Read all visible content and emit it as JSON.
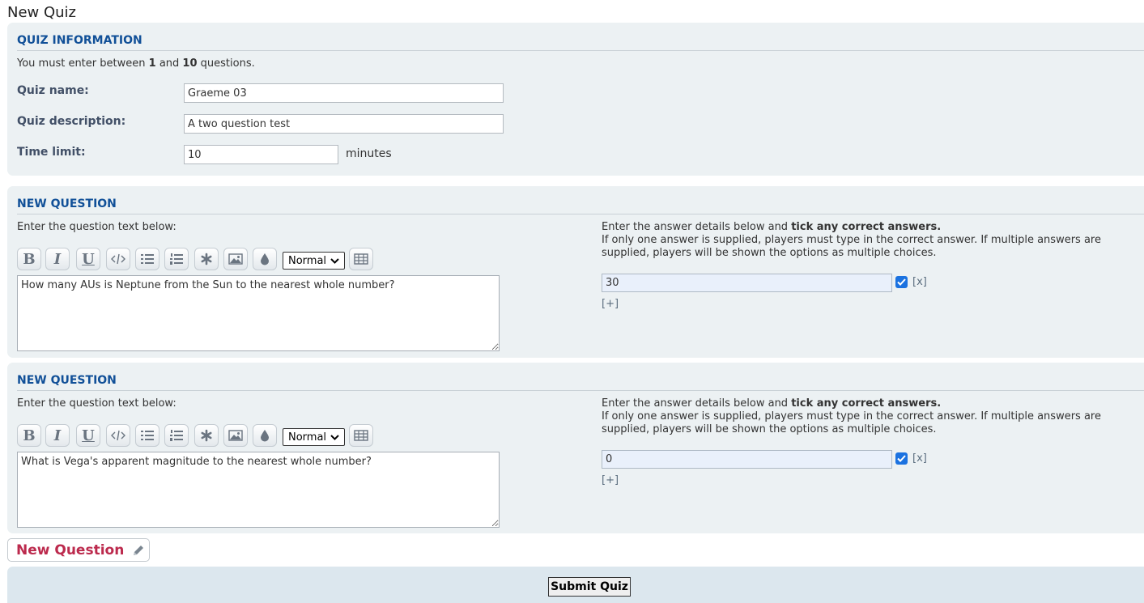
{
  "page": {
    "title": "New Quiz"
  },
  "info": {
    "heading": "QUIZ INFORMATION",
    "note_prefix": "You must enter between",
    "min_questions": "1",
    "note_and": "and",
    "max_questions": "10",
    "note_suffix": "questions.",
    "name_label": "Quiz name:",
    "name_value": "Graeme 03",
    "desc_label": "Quiz description:",
    "desc_value": "A two question test",
    "time_label": "Time limit:",
    "time_value": "10",
    "time_unit": "minutes"
  },
  "questions": [
    {
      "heading": "NEW QUESTION",
      "prompt": "Enter the question text below:",
      "size_option": "Normal",
      "text": "How many AUs is Neptune from the Sun to the nearest whole number?",
      "answer_intro": "Enter the answer details below and",
      "answer_intro_bold": "tick any correct answers.",
      "answer_help": "If only one answer is supplied, players must type in the correct answer. If multiple answers are supplied, players will be shown the options as multiple choices.",
      "answer_value": "30",
      "remove_label": "[x]",
      "add_label": "[+]"
    },
    {
      "heading": "NEW QUESTION",
      "prompt": "Enter the question text below:",
      "size_option": "Normal",
      "text": "What is Vega's apparent magnitude to the nearest whole number?",
      "answer_intro": "Enter the answer details below and",
      "answer_intro_bold": "tick any correct answers.",
      "answer_help": "If only one answer is supplied, players must type in the correct answer. If multiple answers are supplied, players will be shown the options as multiple choices.",
      "answer_value": "0",
      "remove_label": "[x]",
      "add_label": "[+]"
    }
  ],
  "toolbar_icons": [
    "bold-icon",
    "italic-icon",
    "underline-icon",
    "code-icon",
    "bullet-list-icon",
    "numbered-list-icon",
    "asterisk-icon",
    "image-icon",
    "color-drop-icon",
    "table-icon"
  ],
  "actions": {
    "new_question": "New Question",
    "submit": "Submit Quiz"
  },
  "colors": {
    "heading": "#115098",
    "panel": "#ecf1f3",
    "accent": "#bc2a4d",
    "checkbox": "#1b72e0"
  }
}
